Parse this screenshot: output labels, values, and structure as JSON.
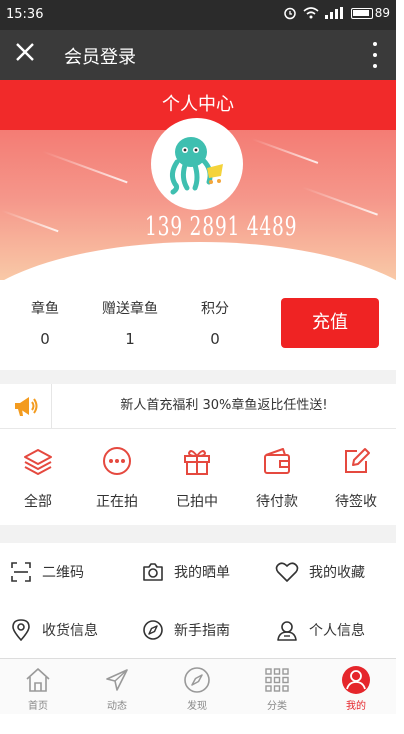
{
  "status_bar": {
    "time": "15:36",
    "battery": "89"
  },
  "title_bar": {
    "title": "会员登录"
  },
  "header": {
    "title": "个人中心"
  },
  "profile": {
    "phone": "139 2891 4489"
  },
  "stats": [
    {
      "label": "章鱼",
      "value": "0"
    },
    {
      "label": "赠送章鱼",
      "value": "1"
    },
    {
      "label": "积分",
      "value": "0"
    }
  ],
  "recharge_label": "充值",
  "notice": {
    "text": "新人首充福利 30%章鱼返比任性送!"
  },
  "orders": [
    {
      "label": "全部",
      "icon": "layers-icon"
    },
    {
      "label": "正在拍",
      "icon": "dots-circle-icon"
    },
    {
      "label": "已拍中",
      "icon": "gift-icon"
    },
    {
      "label": "待付款",
      "icon": "wallet-icon"
    },
    {
      "label": "待签收",
      "icon": "edit-icon"
    }
  ],
  "tools": [
    {
      "label": "二维码",
      "icon": "scan-icon"
    },
    {
      "label": "我的晒单",
      "icon": "camera-icon"
    },
    {
      "label": "我的收藏",
      "icon": "heart-icon"
    },
    {
      "label": "收货信息",
      "icon": "location-icon"
    },
    {
      "label": "新手指南",
      "icon": "compass-icon"
    },
    {
      "label": "个人信息",
      "icon": "person-icon"
    }
  ],
  "tabbar": [
    {
      "label": "首页",
      "icon": "home-icon"
    },
    {
      "label": "动态",
      "icon": "send-icon"
    },
    {
      "label": "发现",
      "icon": "discover-icon"
    },
    {
      "label": "分类",
      "icon": "grid-icon"
    },
    {
      "label": "我的",
      "icon": "user-icon",
      "active": true
    }
  ],
  "colors": {
    "accent": "#f12a2a",
    "icon_red": "#e5493f",
    "title_bar": "#3a3a3a",
    "status_bar": "#2b2b2b"
  }
}
